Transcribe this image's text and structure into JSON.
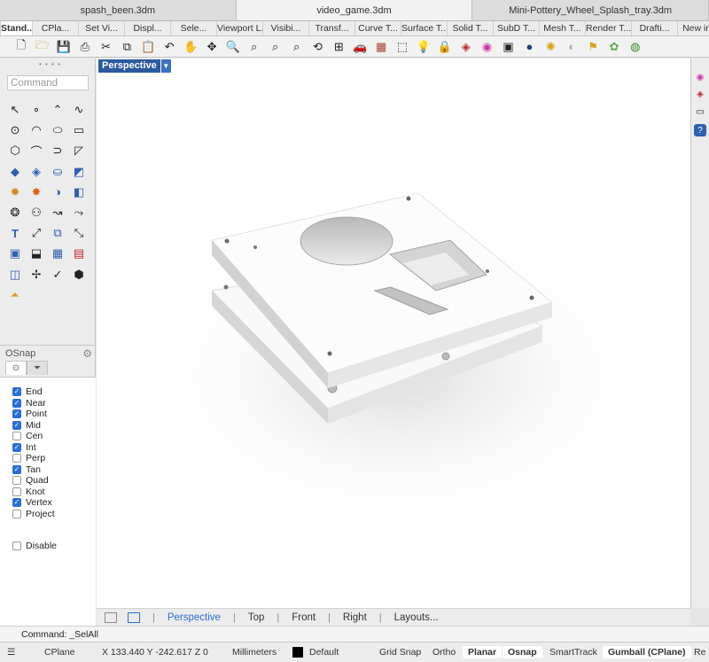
{
  "doc_tabs": [
    "spash_been.3dm",
    "video_game.3dm",
    "Mini-Pottery_Wheel_Splash_tray.3dm"
  ],
  "doc_tab_active": 1,
  "toolbar_tabs": [
    "Stand...",
    "CPla...",
    "Set Vi...",
    "Displ...",
    "Sele...",
    "Viewport L...",
    "Visibi...",
    "Transf...",
    "Curve T...",
    "Surface T...",
    "Solid T...",
    "SubD T...",
    "Mesh T...",
    "Render T...",
    "Drafti...",
    "New in..."
  ],
  "command": {
    "placeholder": "Command"
  },
  "osnap": {
    "title": "OSnap",
    "items": [
      {
        "label": "End",
        "checked": true
      },
      {
        "label": "Near",
        "checked": true
      },
      {
        "label": "Point",
        "checked": true
      },
      {
        "label": "Mid",
        "checked": true
      },
      {
        "label": "Cen",
        "checked": false
      },
      {
        "label": "Int",
        "checked": true
      },
      {
        "label": "Perp",
        "checked": false
      },
      {
        "label": "Tan",
        "checked": true
      },
      {
        "label": "Quad",
        "checked": false
      },
      {
        "label": "Knot",
        "checked": false
      },
      {
        "label": "Vertex",
        "checked": true
      },
      {
        "label": "Project",
        "checked": false
      }
    ],
    "disable": {
      "label": "Disable",
      "checked": false
    }
  },
  "viewport": {
    "label": "Perspective"
  },
  "view_tabs": [
    "Perspective",
    "Top",
    "Front",
    "Right",
    "Layouts..."
  ],
  "view_tab_active": 0,
  "command_history": "Command: _SelAll",
  "status": {
    "cplane": "CPlane",
    "coords": "X 133.440 Y -242.617 Z 0",
    "units": "Millimeters",
    "layer": "Default",
    "grid_snap": "Grid Snap",
    "ortho": "Ortho",
    "planar": "Planar",
    "osnap": "Osnap",
    "smarttrack": "SmartTrack",
    "gumball": "Gumball (CPlane)",
    "record_history": "Re"
  },
  "colors": {
    "accent": "#2a6ed8",
    "viewport_label_bg": "#2a5aa0",
    "model": "#f7f7f7"
  }
}
